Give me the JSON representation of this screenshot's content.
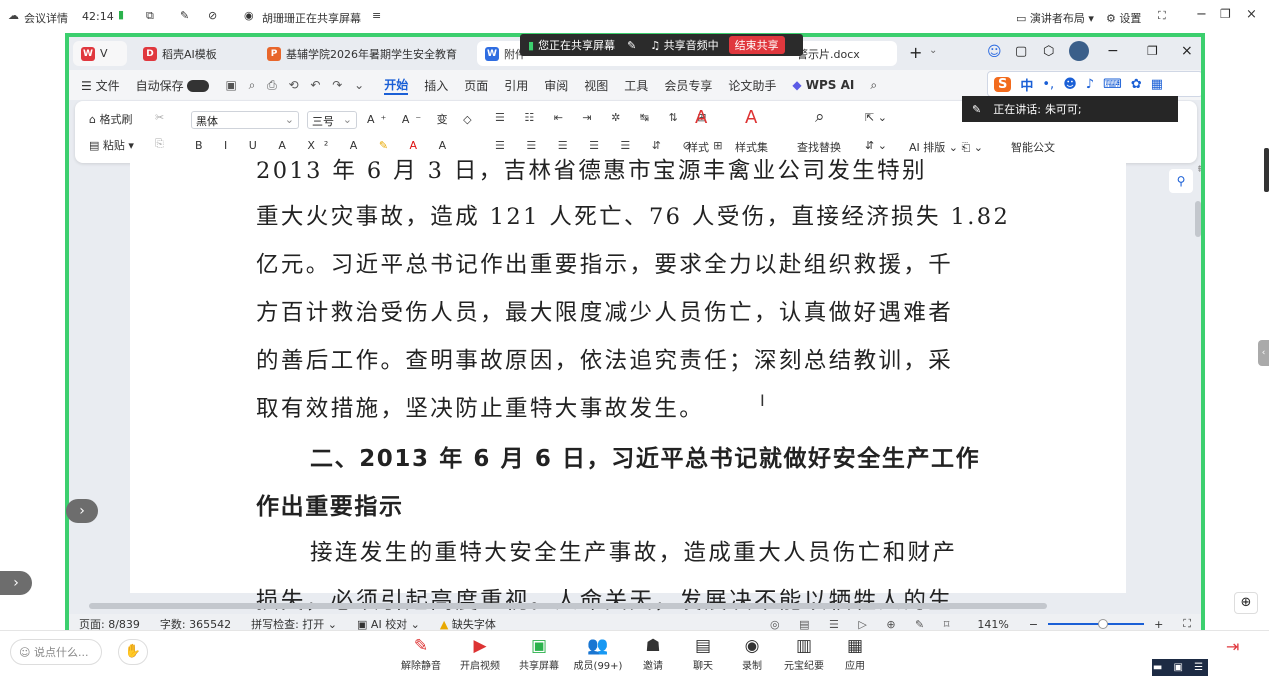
{
  "meeting_bar": {
    "details_label": "会议详情",
    "timer": "42:14",
    "sharing_notice": "胡珊珊正在共享屏幕",
    "presenter_layout": "演讲者布局",
    "settings": "设置"
  },
  "tabs": [
    {
      "icon_letter": "W",
      "label": "V",
      "color": "#e0383e"
    },
    {
      "icon_letter": "D",
      "label": "稻壳AI模板",
      "color": "#e0383e"
    },
    {
      "icon_letter": "P",
      "label": "基辅学院2026年暑期学生安全教育",
      "color": "#e8662b"
    },
    {
      "icon_letter": "W",
      "label": "附件",
      "color": "#2f6de1"
    },
    {
      "icon_letter": "",
      "label": "警示片.docx",
      "color": "#2f6de1"
    }
  ],
  "share_bar": {
    "status": "您正在共享屏幕",
    "audio": "共享音频中",
    "end": "结束共享"
  },
  "menu": {
    "file": "文件",
    "autosave": "自动保存",
    "items": [
      "开始",
      "插入",
      "页面",
      "引用",
      "审阅",
      "视图",
      "工具",
      "会员专享",
      "论文助手"
    ],
    "wps_ai": "WPS AI"
  },
  "ribbon": {
    "format_painter": "格式刷",
    "paste": "粘贴",
    "font": "黑体",
    "font_size": "三号",
    "styles": "样式",
    "style_set": "样式集",
    "find_replace": "查找替换",
    "ai_layout": "AI 排版",
    "smart_doc": "智能公文"
  },
  "ime": {
    "mode": "中"
  },
  "speaking": {
    "label": "正在讲话:",
    "name": "朱可可;"
  },
  "document": {
    "lines": [
      "2013 年 6 月 3 日，吉林省德惠市宝源丰禽业公司发生特别",
      "重大火灾事故，造成 121 人死亡、76 人受伤，直接经济损失 1.82",
      "亿元。习近平总书记作出重要指示，要求全力以赴组织救援，千",
      "方百计救治受伤人员，最大限度减少人员伤亡，认真做好遇难者",
      "的善后工作。查明事故原因，依法追究责任；深刻总结教训，采",
      "取有效措施，坚决防止重特大事故发生。"
    ],
    "heading_line1": "二、2013 年 6 月 6 日，习近平总书记就做好安全生产工作",
    "heading_line2": "作出重要指示",
    "para2_line1": "接连发生的重特大安全生产事故，造成重大人员伤亡和财产",
    "para2_line2": "损失，必须引起高度重视。人命关天，发展决不能以牺牲人的生"
  },
  "status_bar": {
    "page": "页面: 8/839",
    "words": "字数: 365542",
    "spell": "拼写检查: 打开",
    "ai_check": "AI 校对",
    "missing_font": "缺失字体",
    "zoom": "141%"
  },
  "bottom_bar": {
    "chat_placeholder": "说点什么...",
    "buttons": [
      "解除静音",
      "开启视频",
      "共享屏幕",
      "成员(99+)",
      "邀请",
      "聊天",
      "录制",
      "元宝纪要",
      "应用"
    ]
  }
}
